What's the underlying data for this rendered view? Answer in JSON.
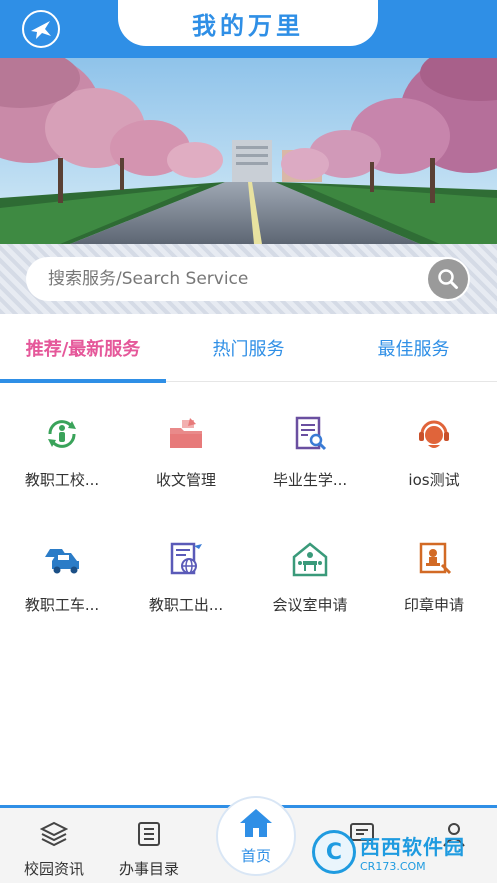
{
  "header": {
    "title": "我的万里",
    "logo_icon": "plane-logo-icon"
  },
  "search": {
    "placeholder": "搜索服务/Search Service",
    "button_icon": "search-icon"
  },
  "tabs": [
    {
      "label": "推荐/最新服务",
      "active": true
    },
    {
      "label": "热门服务",
      "active": false
    },
    {
      "label": "最佳服务",
      "active": false
    }
  ],
  "services": [
    {
      "label": "教职工校...",
      "icon": "refresh-person-icon",
      "color": "#3aa35a"
    },
    {
      "label": "收文管理",
      "icon": "folder-receive-icon",
      "color": "#e77a7a"
    },
    {
      "label": "毕业生学...",
      "icon": "document-search-icon",
      "color": "#6a4fa0"
    },
    {
      "label": "ios测试",
      "icon": "headset-support-icon",
      "color": "#e0643a"
    },
    {
      "label": "教职工车...",
      "icon": "car-icon",
      "color": "#2b7cc7"
    },
    {
      "label": "教职工出...",
      "icon": "travel-document-icon",
      "color": "#5a5ab8"
    },
    {
      "label": "会议室申请",
      "icon": "meeting-room-icon",
      "color": "#3a9a7a"
    },
    {
      "label": "印章申请",
      "icon": "seal-stamp-icon",
      "color": "#d26a25"
    }
  ],
  "bottom_nav": [
    {
      "label": "校园资讯",
      "icon": "layers-icon"
    },
    {
      "label": "办事目录",
      "icon": "list-icon"
    },
    {
      "label": "首页",
      "icon": "home-icon",
      "active": true
    },
    {
      "label": "",
      "icon": "message-icon"
    },
    {
      "label": "",
      "icon": "user-icon"
    }
  ],
  "watermark": {
    "text": "西西软件园",
    "sub": "CR173.COM"
  },
  "colors": {
    "primary": "#2f8fe6",
    "active_tab": "#e5589a"
  }
}
